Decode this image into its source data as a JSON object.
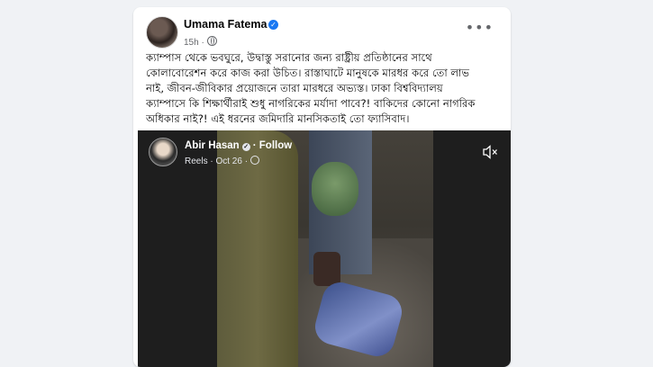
{
  "post": {
    "author": "Umama Fatema",
    "time": "15h ·",
    "text_lines": [
      "ক্যাম্পাস থেকে ভবঘুরে, উদ্বাস্তু সরানোর জন্য রাষ্ট্রীয় প্রতিষ্ঠানের সাথে",
      "কোলাবোরেশন করে কাজ করা উচিত। রাস্তাঘাটে মানুষকে মারধর করে তো লাভ",
      "নাই, জীবন-জীবিকার প্রয়োজনে তারা মারধরে অভ্যস্ত। ঢাকা বিশ্ববিদ্যালয়",
      "ক্যাম্পাসে কি শিক্ষার্থীরাই শুধু নাগরিকের মর্যাদা পাবে?! বাকিদের কোনো নাগরিক",
      "অধিকার নাই?! এই ধরনের জমিদারি মানসিকতাই তো ফ্যাসিবাদ।"
    ]
  },
  "reel": {
    "author": "Abir Hasan",
    "follow_sep": "·",
    "follow_label": "Follow",
    "meta": "Reels · Oct 26 ·"
  },
  "colors": {
    "verified_blue": "#1877f2",
    "secondary_text": "#65676b"
  },
  "icons": {
    "verified": "verified-badge-icon",
    "globe": "globe-icon",
    "more": "more-options-icon",
    "mute": "mute-icon"
  }
}
